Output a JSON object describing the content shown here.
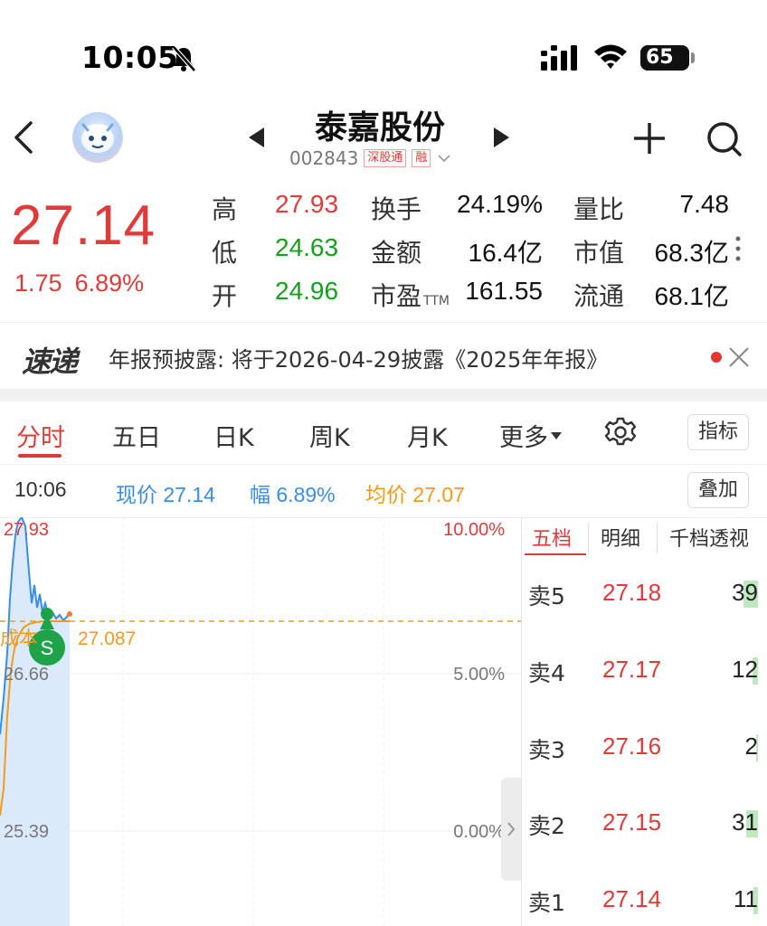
{
  "status_bar": {
    "time": "10:05",
    "battery": "65"
  },
  "nav": {
    "stock_name": "泰嘉股份",
    "stock_code": "002843",
    "tags": [
      "深股通",
      "融"
    ]
  },
  "quote": {
    "price": "27.14",
    "change": "1.75",
    "change_pct": "6.89%",
    "high_label": "高",
    "high": "27.93",
    "low_label": "低",
    "low": "24.63",
    "open_label": "开",
    "open": "24.96",
    "turnover_label": "换手",
    "turnover": "24.19%",
    "amount_label": "金额",
    "amount": "16.4亿",
    "pe_label": "市盈",
    "pe_suffix": "TTM",
    "pe": "161.55",
    "vol_ratio_label": "量比",
    "vol_ratio": "7.48",
    "mkt_cap_label": "市值",
    "mkt_cap": "68.3亿",
    "float_label": "流通",
    "float_cap": "68.1亿"
  },
  "news": {
    "logo": "速递",
    "text": "年报预披露: 将于2026-04-29披露《2025年年报》"
  },
  "tabs": {
    "intraday": "分时",
    "five_day": "五日",
    "daily_k": "日K",
    "weekly_k": "周K",
    "monthly_k": "月K",
    "more": "更多",
    "indicator_btn": "指标",
    "overlay_btn": "叠加"
  },
  "info_bar": {
    "time": "10:06",
    "price": "现价 27.14",
    "pct": "幅 6.89%",
    "avg": "均价 27.07"
  },
  "chart_labels": {
    "top_price": "27.93",
    "top_pct": "10.00%",
    "mid_price": "26.66",
    "mid_pct": "5.00%",
    "base_price": "25.39",
    "base_pct": "0.00%",
    "cost_label": "成本",
    "cost_value": "27.087",
    "signal_letter": "S"
  },
  "order_book": {
    "tabs": [
      "五档",
      "明细",
      "千档透视"
    ],
    "rows": [
      {
        "label": "卖5",
        "price": "27.18",
        "volume": "39"
      },
      {
        "label": "卖4",
        "price": "27.17",
        "volume": "12"
      },
      {
        "label": "卖3",
        "price": "27.16",
        "volume": "2"
      },
      {
        "label": "卖2",
        "price": "27.15",
        "volume": "31"
      },
      {
        "label": "卖1",
        "price": "27.14",
        "volume": "11"
      }
    ]
  },
  "colors": {
    "up": "#e03b3b",
    "down": "#14a01e",
    "price_line": "#3a8de5",
    "avg_line": "#f29a1e"
  }
}
